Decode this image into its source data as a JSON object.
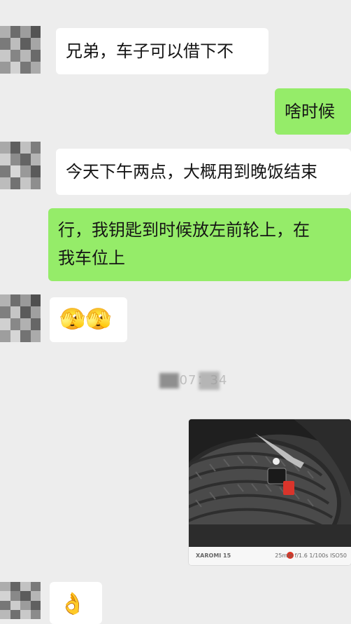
{
  "messages": [
    {
      "side": "left",
      "text": "兄弟，车子可以借下不"
    },
    {
      "side": "right",
      "text": "啥时候"
    },
    {
      "side": "left",
      "text": "今天下午两点，大概用到晚饭结束"
    },
    {
      "side": "right",
      "lines": [
        "行，我钥匙到时候放左前轮上，在",
        "我车位上"
      ]
    },
    {
      "side": "left",
      "emoji": "🫣🫣"
    },
    {
      "side": "left",
      "emoji": "👌"
    }
  ],
  "timestamp": "07：34",
  "photo": {
    "caption_left": "XAROMI 15",
    "caption_right": "25mm f/1.6 1/100s ISO50"
  },
  "colors": {
    "background": "#ededed",
    "bubble_left": "#ffffff",
    "bubble_right": "#95ec69"
  },
  "icons": [
    "avatar-blurred",
    "face-with-monocle-emoji",
    "ok-hand-emoji"
  ]
}
